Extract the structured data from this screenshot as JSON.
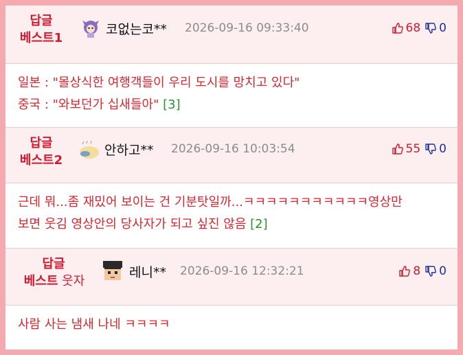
{
  "replies": [
    {
      "badge_top": "답글",
      "badge_bottom": "베스트1",
      "badge_suffix": "",
      "username": "코없는코**",
      "timestamp": "2026-09-16 09:33:40",
      "upvotes": "68",
      "downvotes": "0",
      "lines": [
        {
          "text": "일본 : \"몰상식한 여행객들이 우리 도시를 망치고 있다\"",
          "ref": ""
        },
        {
          "text": "중국 : \"와보던가 십새들아\" ",
          "ref": "[3]"
        }
      ]
    },
    {
      "badge_top": "답글",
      "badge_bottom": "베스트2",
      "badge_suffix": "",
      "username": "안하고**",
      "timestamp": "2026-09-16 10:03:54",
      "upvotes": "55",
      "downvotes": "0",
      "lines": [
        {
          "text": "근데 뭐...좀 재밌어 보이는 건 기분탓일까...ㅋㅋㅋㅋㅋㅋㅋㅋㅋㅋㅋ영상만",
          "ref": ""
        },
        {
          "text": "보면 웃김 영상안의 당사자가 되고 싶진 않음 ",
          "ref": "[2]"
        }
      ]
    },
    {
      "badge_top": "답글",
      "badge_bottom": "베스트",
      "badge_suffix": " 웃자",
      "username": "레니**",
      "timestamp": "2026-09-16 12:32:21",
      "upvotes": "8",
      "downvotes": "0",
      "lines": [
        {
          "text": "사람 사는 냄새 나네 ㅋㅋㅋㅋ",
          "ref": ""
        }
      ]
    }
  ],
  "colors": {
    "frame": "#f5aaaf",
    "header_bg": "#fdeef0",
    "accent_red": "#d11a2f",
    "down_blue": "#1b2fa3",
    "ref_green": "#2e8f2e"
  },
  "icons": [
    "thumbs-up-icon",
    "thumbs-down-icon"
  ]
}
